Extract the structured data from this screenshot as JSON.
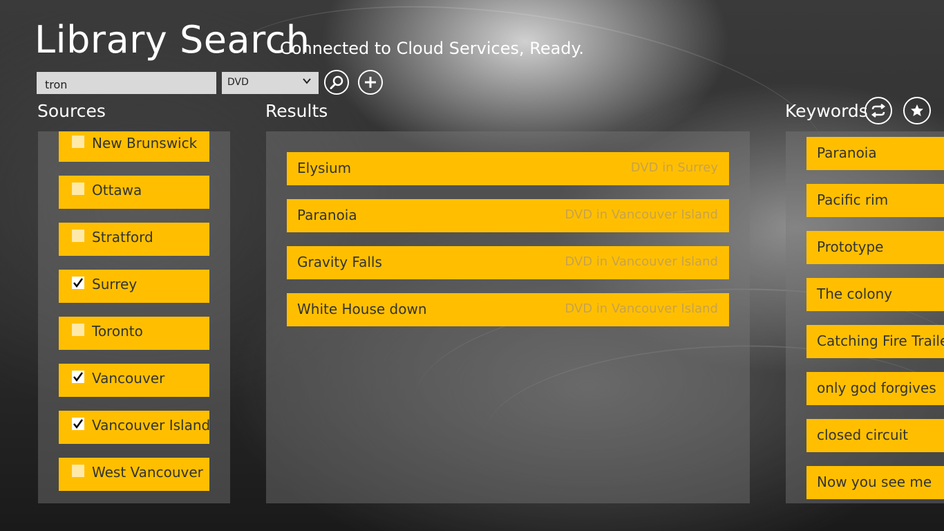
{
  "header": {
    "title": "Library Search",
    "status": "Connected to Cloud Services, Ready."
  },
  "search": {
    "query": "tron",
    "media_type": "DVD"
  },
  "sections": {
    "sources": "Sources",
    "results": "Results",
    "keywords": "Keywords"
  },
  "sources": [
    {
      "label": "New Brunswick",
      "checked": false
    },
    {
      "label": "Ottawa",
      "checked": false
    },
    {
      "label": "Stratford",
      "checked": false
    },
    {
      "label": "Surrey",
      "checked": true
    },
    {
      "label": "Toronto",
      "checked": false
    },
    {
      "label": "Vancouver",
      "checked": true
    },
    {
      "label": "Vancouver Island",
      "checked": true
    },
    {
      "label": "West Vancouver",
      "checked": false
    }
  ],
  "results": [
    {
      "title": "Elysium",
      "location": "DVD in Surrey"
    },
    {
      "title": "Paranoia",
      "location": "DVD in Vancouver Island"
    },
    {
      "title": "Gravity Falls",
      "location": "DVD in Vancouver Island"
    },
    {
      "title": "White House down",
      "location": "DVD in Vancouver Island"
    }
  ],
  "keywords": [
    "Paranoia",
    "Pacific rim",
    "Prototype",
    "The colony",
    "Catching Fire Trailer",
    "only god forgives",
    "closed circuit",
    "Now you see me"
  ],
  "colors": {
    "accent": "#ffbf00",
    "location_text": "#c9a24a"
  },
  "icons": {
    "search": "magnifier-icon",
    "add": "plus-icon",
    "refresh": "refresh-icon",
    "favorite": "star-icon"
  }
}
